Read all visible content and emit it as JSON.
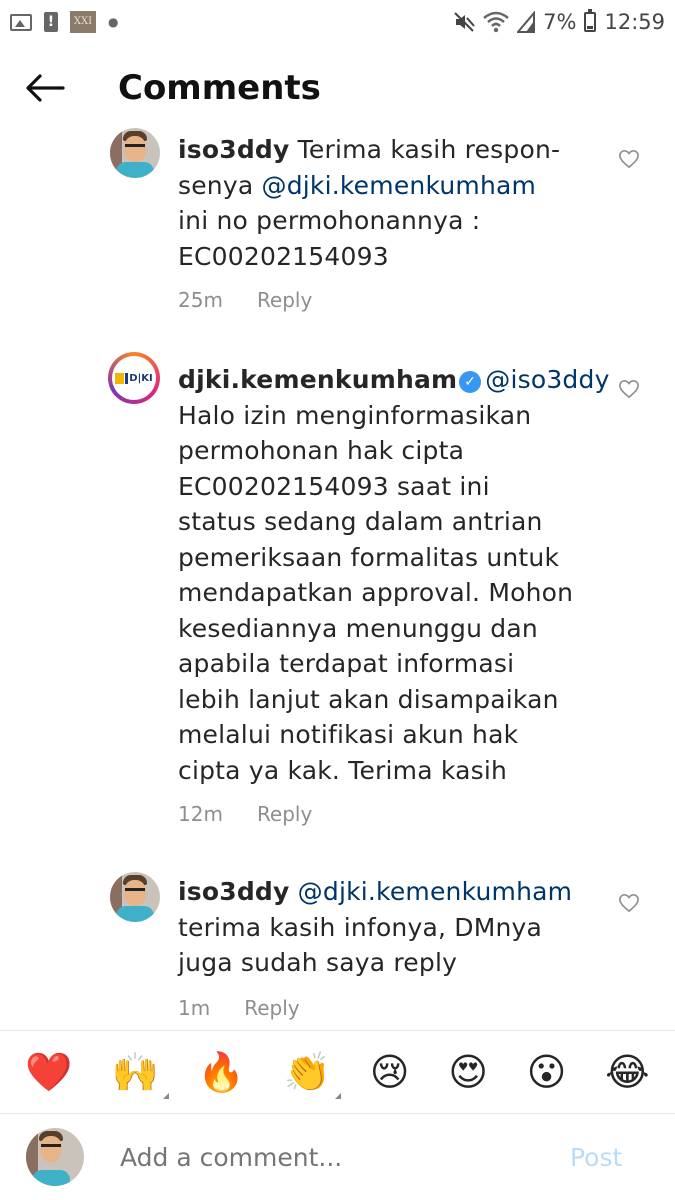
{
  "status_bar": {
    "left_icons": [
      "image-icon",
      "alert-icon",
      "xxi-app-icon",
      "dot-icon"
    ],
    "xxi_label": "XXI",
    "battery_text": "7%",
    "time": "12:59",
    "right_icons": [
      "mute-icon",
      "wifi-icon",
      "signal-icon",
      "battery-icon"
    ]
  },
  "header": {
    "back_icon": "arrow-left-icon",
    "title": "Comments"
  },
  "comments": [
    {
      "username": "iso3ddy",
      "text_lines": [
        "Terima kasih respon-",
        "senya ",
        "ini no permohonannya :",
        "EC00202154093"
      ],
      "mention": "@djki.kemenkumham",
      "time": "25m",
      "reply": "Reply"
    },
    {
      "username": "djki.kemenkumham",
      "verified": true,
      "mention": "@iso3ddy",
      "text_lines": [
        "Halo izin menginformasikan",
        "permohonan hak cipta",
        "EC00202154093 saat ini",
        "status sedang dalam antrian",
        "pemeriksaan formalitas untuk",
        "mendapatkan approval. Mohon",
        "kesediannya menunggu dan",
        "apabila terdapat informasi",
        "lebih lanjut akan disampaikan",
        "melalui notifikasi akun hak",
        "cipta ya kak. Terima kasih"
      ],
      "time": "12m",
      "reply": "Reply"
    },
    {
      "username": "iso3ddy",
      "mention": "@djki.kemenkumham",
      "text_lines": [
        "terima kasih infonya, DMnya",
        "juga sudah saya reply"
      ],
      "time": "1m",
      "reply": "Reply"
    }
  ],
  "emoji_bar": [
    "❤️",
    "🙌",
    "🔥",
    "👏",
    "😢",
    "😍",
    "😮",
    "😂"
  ],
  "composer": {
    "placeholder": "Add a comment...",
    "post_label": "Post"
  },
  "colors": {
    "mention": "#003569",
    "meta": "#8e8e8e",
    "post_disabled": "#b8dcf8",
    "verified": "#3897f0"
  }
}
